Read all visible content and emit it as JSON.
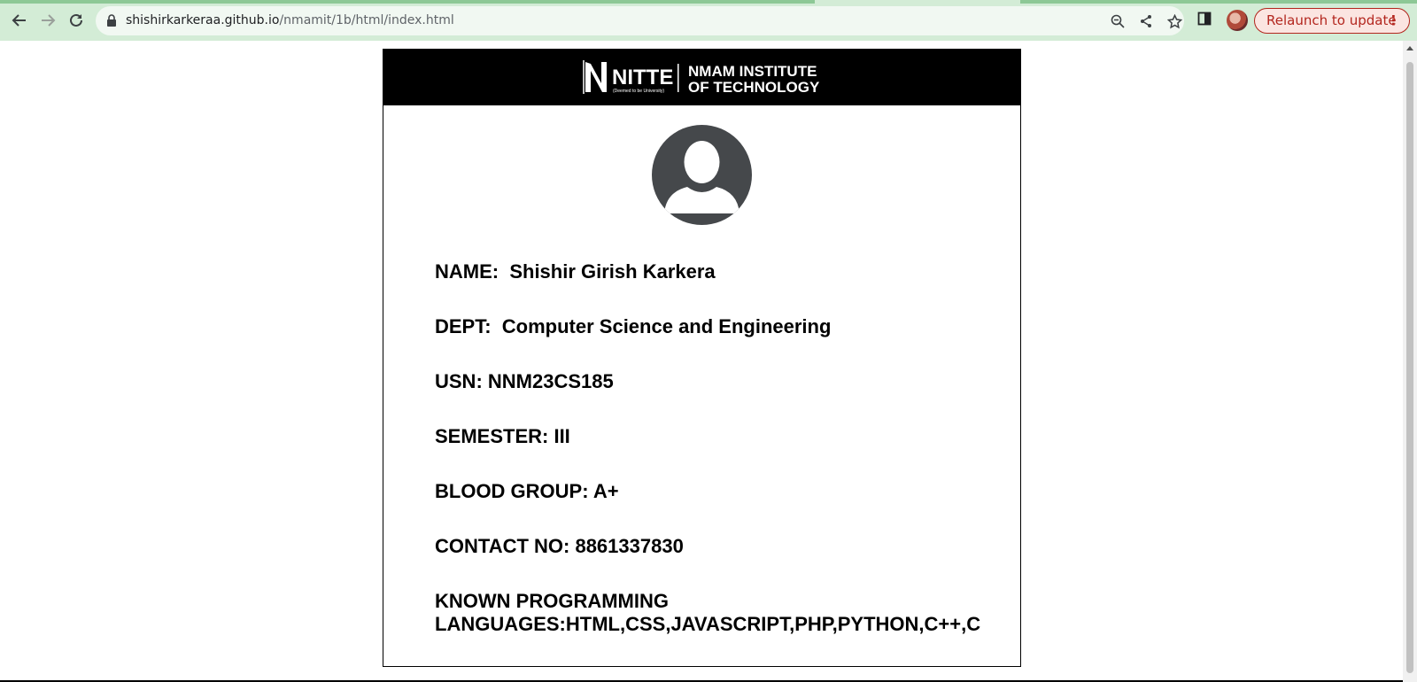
{
  "browser": {
    "url_host": "shishirkarkeraa.github.io",
    "url_path": "/nmamit/1b/html/index.html",
    "relaunch_label": "Relaunch to update",
    "relaunch_menu": "⋮",
    "accent": "#b3261e",
    "chrome_color": "#d3ecd6"
  },
  "card": {
    "logo": {
      "brand": "NITTE",
      "tagline": "(Deemed to be University)",
      "institute_line1": "NMAM INSTITUTE",
      "institute_line2": "OF TECHNOLOGY"
    },
    "fields": {
      "name": "NAME:  Shishir Girish Karkera",
      "dept": "DEPT:  Computer Science and Engineering",
      "usn": "USN: NNM23CS185",
      "semester": "SEMESTER: III",
      "blood_group": "BLOOD GROUP: A+",
      "contact": "CONTACT NO: 8861337830",
      "languages": "KNOWN PROGRAMMING LANGUAGES:HTML,CSS,JAVASCRIPT,PHP,PYTHON,C++,C"
    }
  }
}
